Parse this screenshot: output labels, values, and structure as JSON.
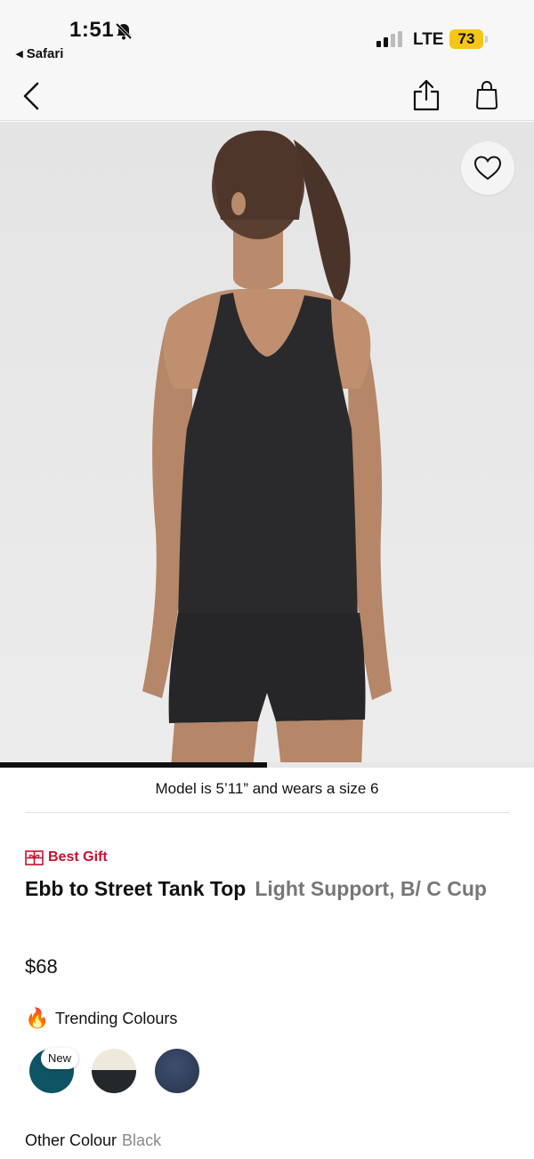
{
  "status_bar": {
    "time": "1:51",
    "back_app": "◂ Safari",
    "network": "LTE",
    "battery": "73",
    "icons": [
      "bell-slash-icon",
      "signal-icon"
    ]
  },
  "nav": {
    "icons": [
      "back-chevron-icon",
      "share-icon",
      "shopping-bag-icon"
    ]
  },
  "hero": {
    "image": "model-back-view-tank-top",
    "favorite_icon": "heart-icon",
    "carousel_progress": 0.5
  },
  "product": {
    "model_caption": "Model is 5’11” and wears a size 6",
    "badge": "Best Gift",
    "badge_icon": "gift-icon",
    "name": "Ebb to Street Tank Top",
    "subtitle": "Light Support, B/ C Cup",
    "price": "$68",
    "trending_label": "Trending Colours",
    "trending_icon": "🔥",
    "swatches": [
      {
        "color": "#0f5464",
        "tag": "New"
      },
      {
        "color": "#efe9dc/#25282b"
      },
      {
        "color": "#2e3c56"
      }
    ],
    "other_colour_label": "Other Colour",
    "other_colour_value": "Black"
  },
  "colors": {
    "accent_red": "#c8102e",
    "text_muted": "#777777",
    "status_bg": "#f7f7f7"
  }
}
